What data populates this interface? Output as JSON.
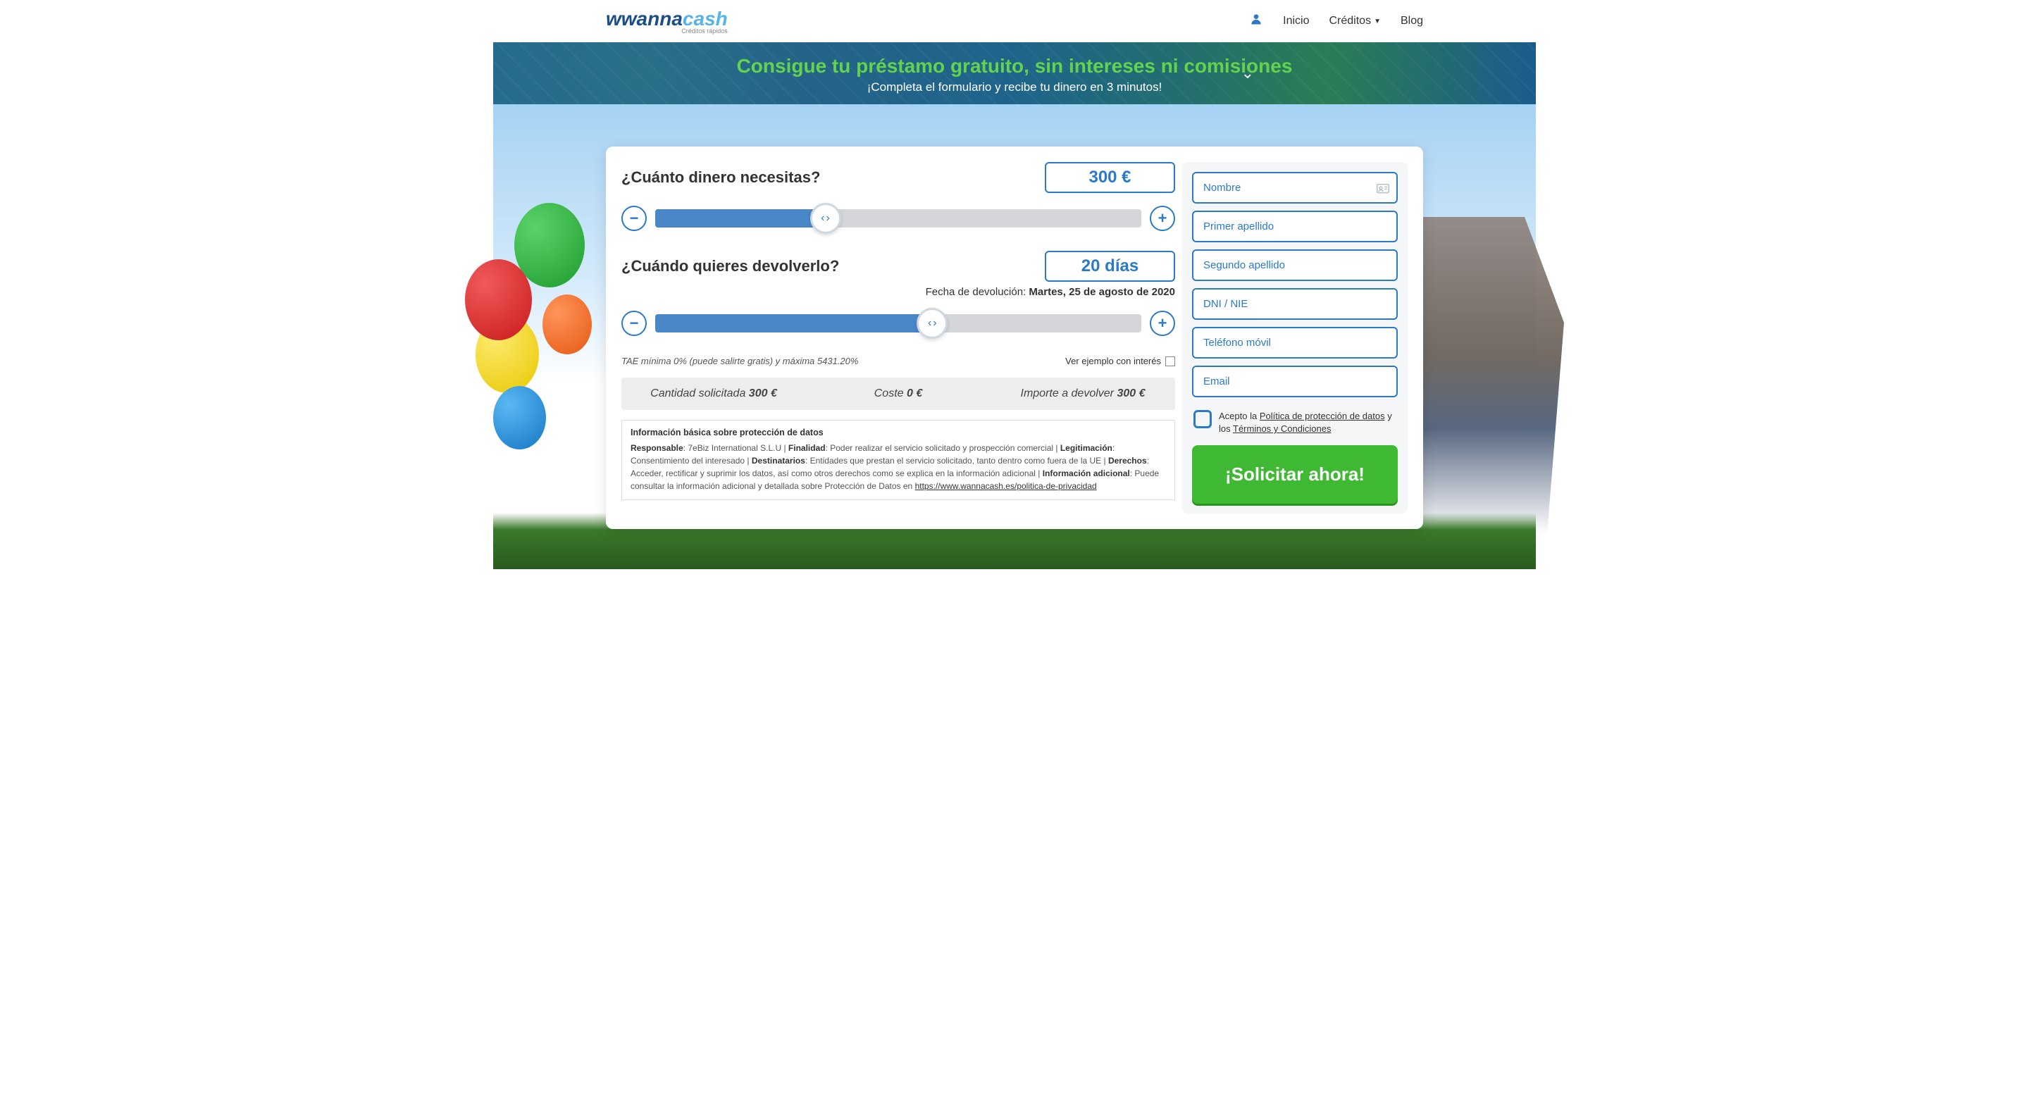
{
  "header": {
    "logo_part1": "wanna",
    "logo_part2": "cash",
    "logo_sub": "Créditos rápidos",
    "nav": {
      "inicio": "Inicio",
      "creditos": "Créditos",
      "blog": "Blog"
    }
  },
  "banner": {
    "title": "Consigue tu préstamo gratuito, sin intereses ni comisiones",
    "subtitle": "¡Completa el formulario y recibe tu dinero en 3 minutos!"
  },
  "calc": {
    "q_amount": "¿Cuánto dinero necesitas?",
    "amount_value": "300 €",
    "q_term": "¿Cuándo quieres devolverlo?",
    "term_value": "20 días",
    "return_date_label": "Fecha de devolución: ",
    "return_date_value": "Martes, 25 de agosto de 2020",
    "tae_note": "TAE mínima 0% (puede salirte gratis) y máxima 5431.20%",
    "example_label": "Ver ejemplo con interés",
    "summary": {
      "requested_label": "Cantidad solicitada ",
      "requested_value": "300 €",
      "cost_label": "Coste ",
      "cost_value": "0 €",
      "total_label": "Importe a devolver ",
      "total_value": "300 €"
    },
    "legal": {
      "title": "Información básica sobre protección de datos",
      "responsable_k": "Responsable",
      "responsable_v": ": 7eBiz International S.L.U | ",
      "finalidad_k": "Finalidad",
      "finalidad_v": ": Poder realizar el servicio solicitado y prospección comercial | ",
      "legitimacion_k": "Legitimación",
      "legitimacion_v": ": Consentimiento del interesado | ",
      "destinatarios_k": "Destinatarios",
      "destinatarios_v": ": Entidades que prestan el servicio solicitado, tanto dentro como fuera de la UE | ",
      "derechos_k": "Derechos",
      "derechos_v": ": Acceder, rectificar y suprimir los datos, así como otros derechos como se explica en la información adicional | ",
      "adicional_k": "Información adicional",
      "adicional_v": ": Puede consultar la información adicional y detallada sobre Protección de Datos en ",
      "link": "https://www.wannacash.es/politica-de-privacidad"
    }
  },
  "form": {
    "nombre": "Nombre",
    "apellido1": "Primer apellido",
    "apellido2": "Segundo apellido",
    "dni": "DNI / NIE",
    "tel": "Teléfono móvil",
    "email": "Email",
    "accept_prefix": "Acepto la ",
    "accept_policy": "Política de protección de datos",
    "accept_mid": " y los ",
    "accept_terms": "Términos y Condiciones",
    "cta": "¡Solicitar ahora!"
  }
}
